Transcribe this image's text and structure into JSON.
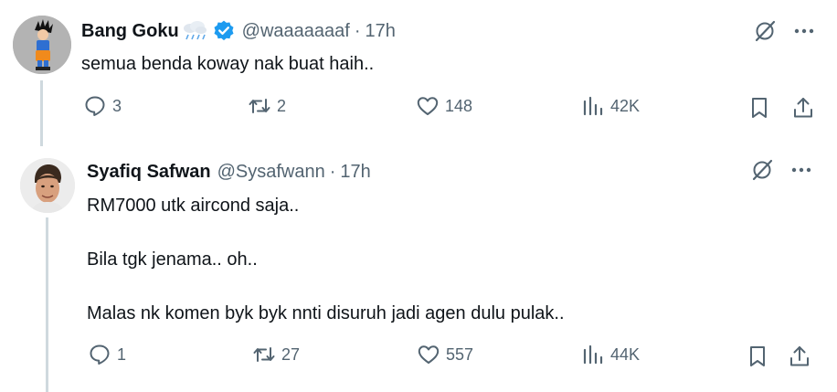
{
  "tweets": [
    {
      "display_name": "Bang Goku",
      "handle": "@waaaaaaaf",
      "separator": "·",
      "time": "17h",
      "text_lines": [
        "semua benda koway nak buat haih.."
      ],
      "replies": "3",
      "reposts": "2",
      "likes": "148",
      "views": "42K",
      "icons": [
        "cloud-rain-emoji",
        "verified-badge-icon",
        "grok-icon",
        "more-icon",
        "reply-icon",
        "repost-icon",
        "like-icon",
        "views-icon",
        "bookmark-icon",
        "share-icon"
      ]
    },
    {
      "display_name": "Syafiq Safwan",
      "handle": "@Sysafwann",
      "separator": "·",
      "time": "17h",
      "text_lines": [
        "RM7000 utk aircond saja..",
        "Bila tgk jenama.. oh..",
        "Malas nk komen byk byk nnti disuruh jadi agen dulu pulak.."
      ],
      "replies": "1",
      "reposts": "27",
      "likes": "557",
      "views": "44K"
    }
  ],
  "colors": {
    "text_primary": "#0f1419",
    "text_secondary": "#536471",
    "verified_blue": "#1d9bf0",
    "thread_line": "#cfd9de"
  }
}
